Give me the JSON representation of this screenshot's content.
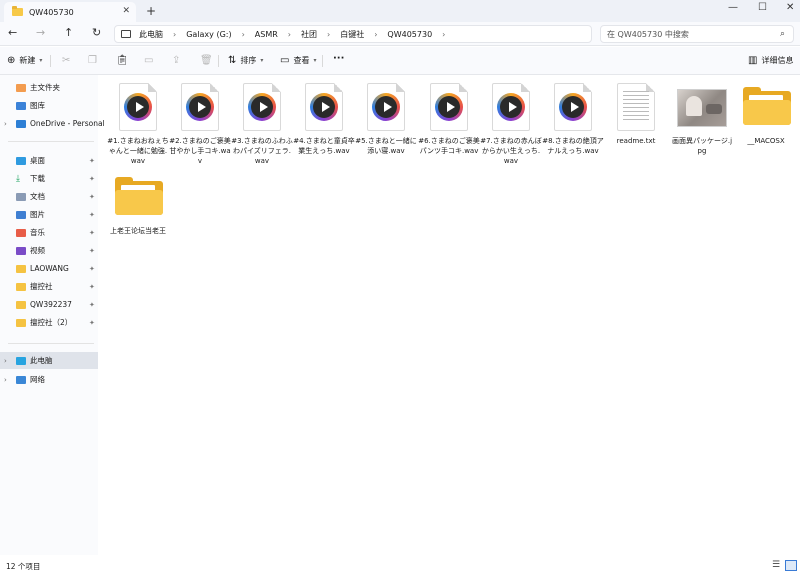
{
  "tab": {
    "title": "QW405730",
    "close": "✕",
    "new": "+"
  },
  "window": {
    "minimize": "—",
    "maximize": "☐",
    "close": "✕"
  },
  "nav": {
    "back": "←",
    "forward": "→",
    "up": "↑",
    "refresh": "↻"
  },
  "breadcrumb": [
    "此电脑",
    "Galaxy (G:)",
    "ASMR",
    "社团",
    "白键社",
    "QW405730"
  ],
  "search": {
    "placeholder": "在 QW405730 中搜索"
  },
  "toolbar": {
    "new_label": "新建",
    "sort_label": "排序",
    "view_label": "查看",
    "more_label": "···",
    "details_label": "详细信息"
  },
  "sidebar": {
    "items": [
      {
        "label": "主文件夹",
        "icon": "home-icon"
      },
      {
        "label": "图库",
        "icon": "gallery-icon"
      },
      {
        "label": "OneDrive - Personal",
        "icon": "cloud-icon"
      },
      {
        "label": "桌面",
        "icon": "desktop-icon"
      },
      {
        "label": "下载",
        "icon": "download-icon"
      },
      {
        "label": "文档",
        "icon": "document-icon"
      },
      {
        "label": "图片",
        "icon": "pictures-icon"
      },
      {
        "label": "音乐",
        "icon": "music-icon"
      },
      {
        "label": "视频",
        "icon": "video-icon"
      },
      {
        "label": "LAOWANG",
        "icon": "folder-icon"
      },
      {
        "label": "擅控社",
        "icon": "folder-icon"
      },
      {
        "label": "QW392237",
        "icon": "folder-icon"
      },
      {
        "label": "擅控社（2）",
        "icon": "folder-icon"
      },
      {
        "label": "此电脑",
        "icon": "pc-icon"
      },
      {
        "label": "网络",
        "icon": "network-icon"
      }
    ]
  },
  "files": [
    {
      "name": "#1.さまねおねぇちゃんと一緒に勉強.wav",
      "type": "audio"
    },
    {
      "name": "#2.さまねのご褒美甘やかし手コキ.wav",
      "type": "audio"
    },
    {
      "name": "#3.さまねのふわふわパイズリフェラ.wav",
      "type": "audio"
    },
    {
      "name": "#4.さまねと童貞卒業生えっち.wav",
      "type": "audio"
    },
    {
      "name": "#5.さまねと一緒に添い寝.wav",
      "type": "audio"
    },
    {
      "name": "#6.さまねのご褒美パンツ手コキ.wav",
      "type": "audio"
    },
    {
      "name": "#7.さまねの赤んぼからかい生えっち.wav",
      "type": "audio"
    },
    {
      "name": "#8.さまねの絶頂アナルえっち.wav",
      "type": "audio"
    },
    {
      "name": "readme.txt",
      "type": "text"
    },
    {
      "name": "画面異パッケージ.jpg",
      "type": "image"
    },
    {
      "name": "__MACOSX",
      "type": "folder"
    },
    {
      "name": "上老王论坛当老王",
      "type": "folder"
    }
  ],
  "status": {
    "count": "12 个项目"
  },
  "colors": {
    "accent": "#3a7bd5",
    "folder": "#f8c84a",
    "selected": "#dfe3ea"
  }
}
